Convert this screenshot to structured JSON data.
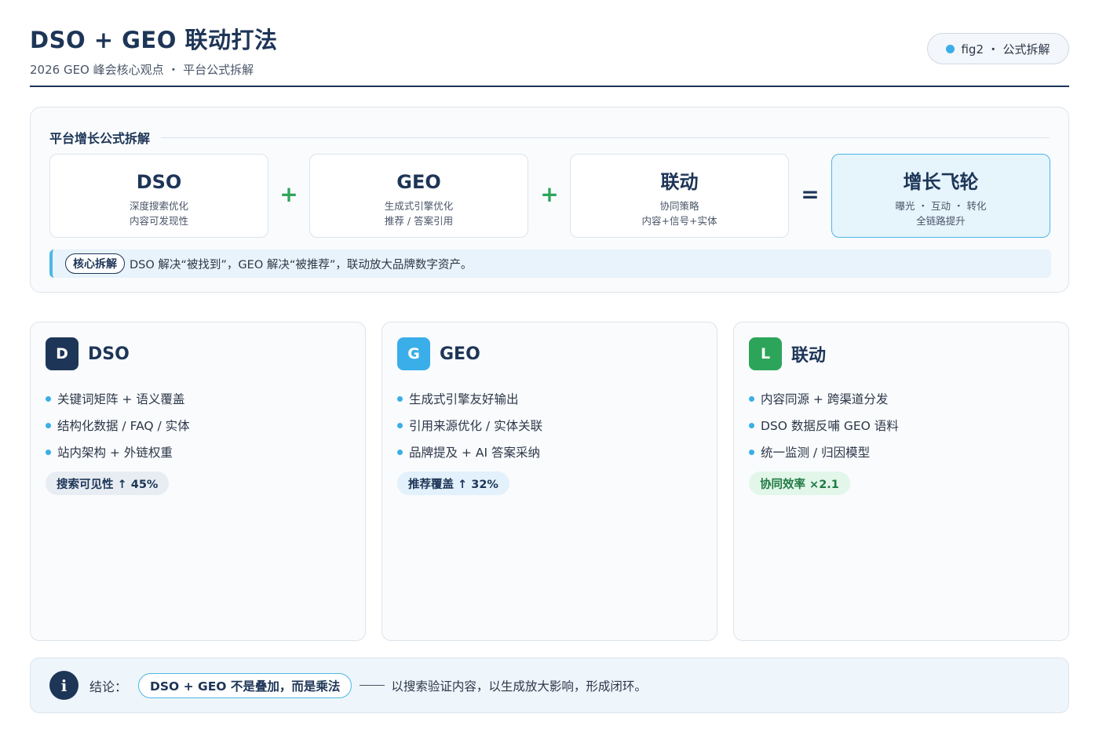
{
  "header": {
    "title": "DSO + GEO 联动打法",
    "subtitle": "2026 GEO 峰会核心观点 ・ 平台公式拆解",
    "tag": "fig2 ・ 公式拆解"
  },
  "formula": {
    "section_title": "平台增长公式拆解",
    "boxes": [
      {
        "title": "DSO",
        "line1": "深度搜索优化",
        "line2": "内容可发现性"
      },
      {
        "title": "GEO",
        "line1": "生成式引擎优化",
        "line2": "推荐 / 答案引用"
      },
      {
        "title": "联动",
        "line1": "协同策略",
        "line2": "内容+信号+实体"
      },
      {
        "title": "增长飞轮",
        "line1": "曝光 ・ 互动 ・ 转化",
        "line2": "全链路提升"
      }
    ],
    "operators": [
      "+",
      "+",
      "="
    ],
    "core_badge": "核心拆解",
    "core_text": "DSO 解决“被找到”，GEO 解决“被推荐”，联动放大品牌数字资产。"
  },
  "cards": [
    {
      "letter": "D",
      "title": "DSO",
      "color": "#1d3557",
      "items": [
        "关键词矩阵 + 语义覆盖",
        "结构化数据 / FAQ / 实体",
        "站内架构 + 外链权重"
      ],
      "metric": "搜索可见性 ↑ 45%",
      "metric_bg": "#e8edf3"
    },
    {
      "letter": "G",
      "title": "GEO",
      "color": "#3aaee8",
      "items": [
        "生成式引擎友好输出",
        "引用来源优化 / 实体关联",
        "品牌提及 + AI 答案采纳"
      ],
      "metric": "推荐覆盖 ↑ 32%",
      "metric_bg": "#e2f1fb"
    },
    {
      "letter": "L",
      "title": "联动",
      "color": "#2ca55a",
      "items": [
        "内容同源 + 跨渠道分发",
        "DSO 数据反哺 GEO 语料",
        "统一监测 / 归因模型"
      ],
      "metric": "协同效率 ×2.1",
      "metric_bg": "#e3f6ea",
      "metric_color": "#1f7a43"
    }
  ],
  "conclusion": {
    "icon": "i",
    "label": "结论：",
    "pill": "DSO + GEO 不是叠加，而是乘法",
    "text": "以搜索验证内容，以生成放大影响，形成闭环。"
  }
}
